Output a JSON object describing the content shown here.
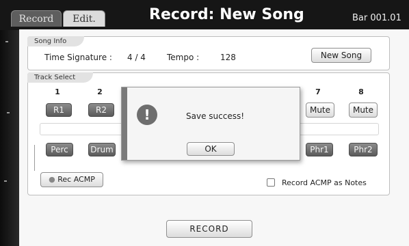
{
  "header": {
    "tabs": [
      {
        "label": "Record",
        "active": true
      },
      {
        "label": "Edit.",
        "active": false
      }
    ],
    "title": "Record: New Song",
    "bar_readout": "Bar 001.01"
  },
  "song_info": {
    "label": "Song Info",
    "time_signature_label": "Time Signature :",
    "time_signature_value": "4 / 4",
    "tempo_label": "Tempo :",
    "tempo_value": "128",
    "new_song_button": "New Song"
  },
  "track_select": {
    "label": "Track Select",
    "numbers": [
      "1",
      "2",
      "7",
      "8"
    ],
    "row1": [
      "R1",
      "R2",
      "Mute",
      "Mute"
    ],
    "row2": [
      "Perc",
      "Drum",
      "Phr1",
      "Phr2"
    ],
    "rec_acmp_button": "Rec ACMP",
    "record_acmp_notes_label": "Record ACMP as Notes"
  },
  "record_button": "RECORD",
  "dialog": {
    "message": "Save success!",
    "ok_button": "OK",
    "icon": "exclamation-icon"
  },
  "colors": {
    "header_bg": "#161616",
    "panel_bg": "#f7f7f7",
    "dark_button": "#6e6e6e"
  }
}
